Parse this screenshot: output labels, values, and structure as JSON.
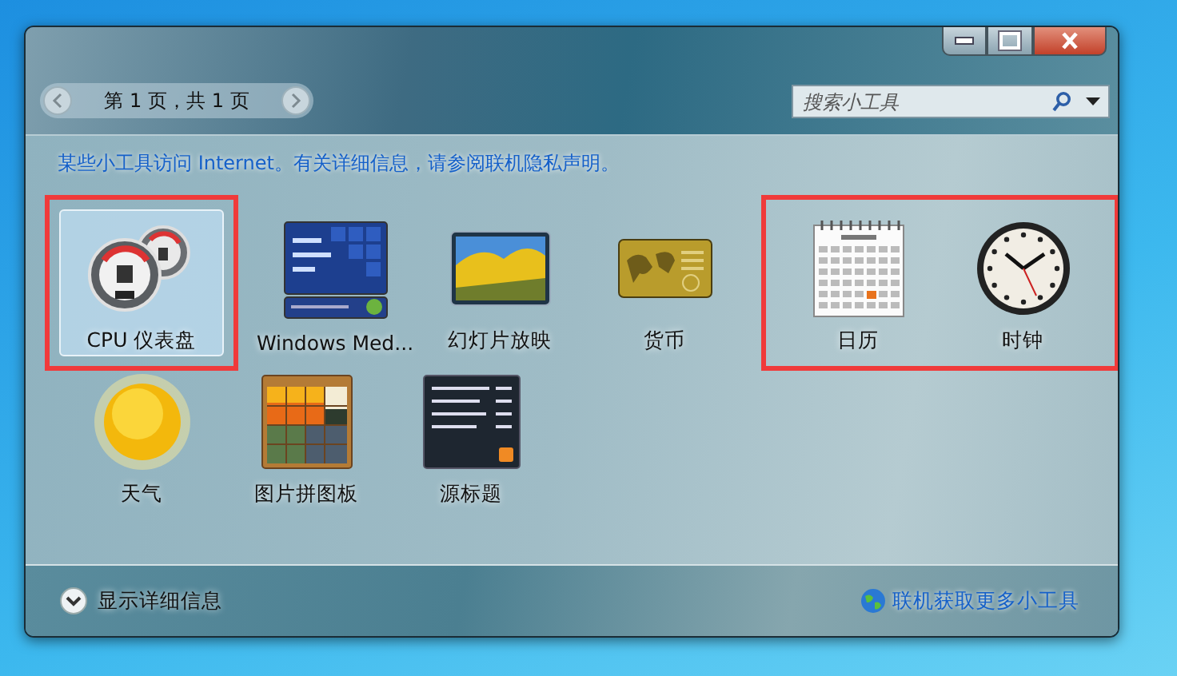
{
  "pager": {
    "label": "第 1 页，共 1 页"
  },
  "search": {
    "placeholder": "搜索小工具"
  },
  "notice": "某些小工具访问 Internet。有关详细信息，请参阅联机隐私声明。",
  "gadget_rows": [
    [
      {
        "highlighted": true,
        "items": [
          {
            "kind": "cpu",
            "label": "CPU 仪表盘",
            "selected": true
          }
        ]
      },
      {
        "highlighted": false,
        "items": [
          {
            "kind": "media",
            "label": "Windows Med...",
            "selected": false
          },
          {
            "kind": "slideshow",
            "label": "幻灯片放映",
            "selected": false
          },
          {
            "kind": "currency",
            "label": "货币",
            "selected": false
          }
        ]
      },
      {
        "highlighted": true,
        "items": [
          {
            "kind": "calendar",
            "label": "日历",
            "selected": false
          },
          {
            "kind": "clock",
            "label": "时钟",
            "selected": false
          }
        ]
      }
    ],
    [
      {
        "highlighted": false,
        "items": [
          {
            "kind": "weather",
            "label": "天气",
            "selected": false
          },
          {
            "kind": "puzzle",
            "label": "图片拼图板",
            "selected": false
          },
          {
            "kind": "feed",
            "label": "源标题",
            "selected": false
          }
        ]
      }
    ]
  ],
  "footer": {
    "details": "显示详细信息",
    "more_link": "联机获取更多小工具"
  }
}
